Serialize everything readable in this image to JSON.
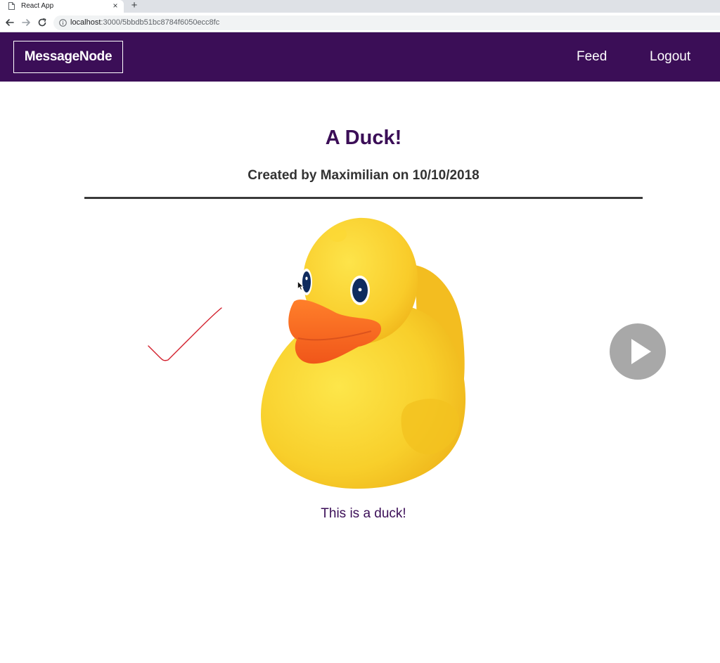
{
  "browser": {
    "tab_title": "React App",
    "tab_close": "×",
    "new_tab": "+",
    "url_host": "localhost",
    "url_path": ":3000/5bbdb51bc8784f6050ecc8fc"
  },
  "header": {
    "logo": "MessageNode",
    "nav": [
      {
        "label": "Feed"
      },
      {
        "label": "Logout"
      }
    ]
  },
  "post": {
    "title": "A Duck!",
    "meta": "Created by Maximilian on 10/10/2018",
    "content": "This is a duck!"
  },
  "colors": {
    "brand": "#3b0e57",
    "text": "#333333",
    "annotation": "#d21e2b",
    "play_button": "#a8a8a8"
  },
  "icons": [
    "doc-icon",
    "close-icon",
    "plus-icon",
    "back-arrow-icon",
    "forward-arrow-icon",
    "reload-icon",
    "info-icon",
    "checkmark-annotation",
    "play-icon",
    "cursor-icon"
  ]
}
